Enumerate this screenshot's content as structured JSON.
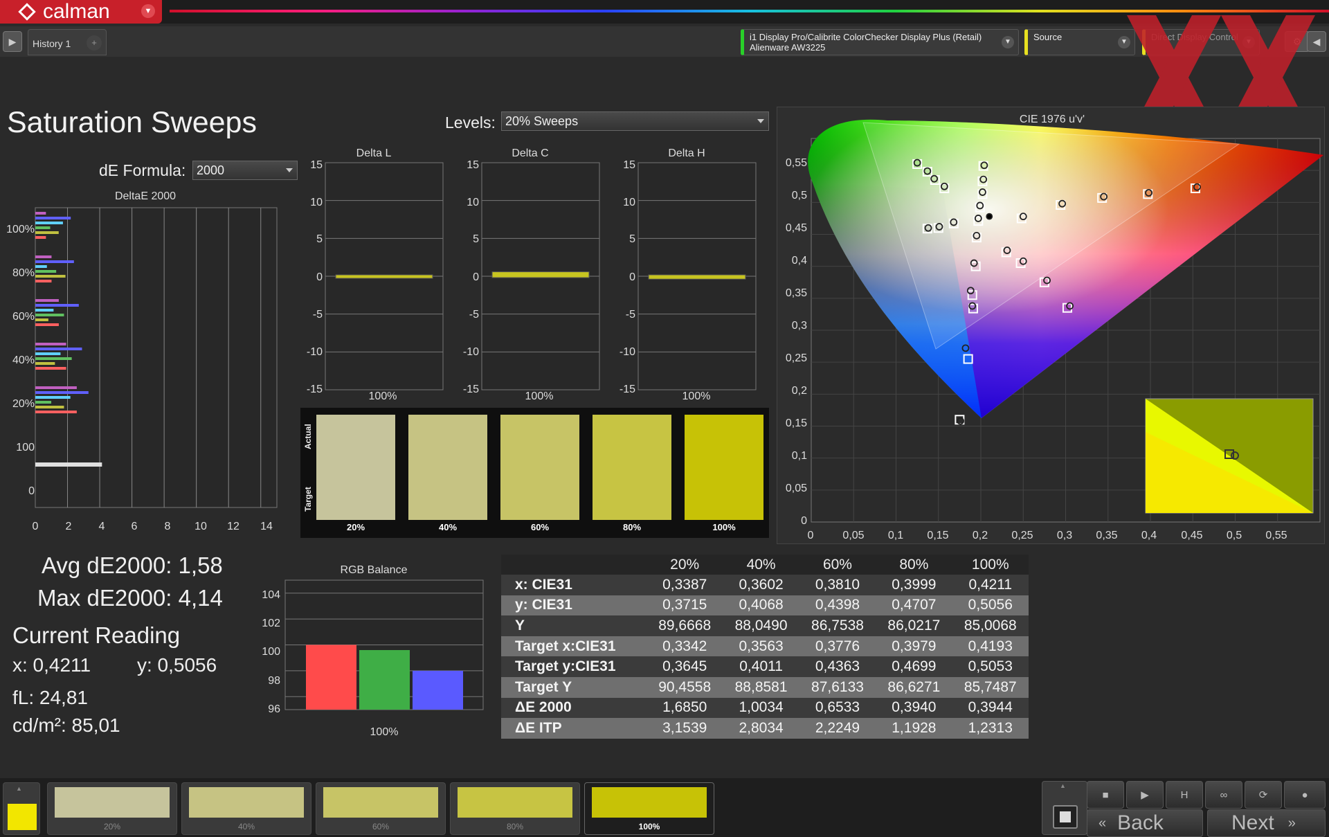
{
  "app": {
    "logo_text": "calman"
  },
  "tab": {
    "label": "History 1",
    "add": "+"
  },
  "devices": {
    "meter_line1": "i1 Display Pro/Calibrite ColorChecker Display Plus (Retail)",
    "meter_line2": "Alienware AW3225",
    "source": "Source",
    "display_control": "Direct Display Control"
  },
  "page": {
    "title": "Saturation Sweeps",
    "levels_label": "Levels:",
    "levels_value": "20% Sweeps",
    "de_label": "dE Formula:",
    "de_value": "2000"
  },
  "charts": {
    "deltae": {
      "title": "DeltaE 2000",
      "y_ticks": [
        "100%",
        "80%",
        "60%",
        "40%",
        "20%",
        "100",
        "0"
      ],
      "x_ticks": [
        "0",
        "2",
        "4",
        "6",
        "8",
        "10",
        "12",
        "14"
      ]
    },
    "delta_l": {
      "title": "Delta L",
      "y_ticks": [
        "15",
        "10",
        "5",
        "0",
        "-5",
        "-10",
        "-15"
      ],
      "x_label": "100%"
    },
    "delta_c": {
      "title": "Delta C",
      "y_ticks": [
        "15",
        "10",
        "5",
        "0",
        "-5",
        "-10",
        "-15"
      ],
      "x_label": "100%"
    },
    "delta_h": {
      "title": "Delta H",
      "y_ticks": [
        "15",
        "10",
        "5",
        "0",
        "-5",
        "-10",
        "-15"
      ],
      "x_label": "100%"
    },
    "rgb": {
      "title": "RGB Balance",
      "y_ticks": [
        "104",
        "102",
        "100",
        "98",
        "96"
      ],
      "x_label": "100%"
    },
    "cie": {
      "title": "CIE 1976 u'v'",
      "x_ticks": [
        "0",
        "0,05",
        "0,1",
        "0,15",
        "0,2",
        "0,25",
        "0,3",
        "0,35",
        "0,4",
        "0,45",
        "0,5",
        "0,55"
      ],
      "y_ticks": [
        "0,55",
        "0,5",
        "0,45",
        "0,4",
        "0,35",
        "0,3",
        "0,25",
        "0,2",
        "0,15",
        "0,1",
        "0,05",
        "0"
      ]
    }
  },
  "swatches": {
    "actual_label": "Actual",
    "target_label": "Target",
    "items": [
      {
        "label": "20%",
        "color": "#c6c49c"
      },
      {
        "label": "40%",
        "color": "#c6c383"
      },
      {
        "label": "60%",
        "color": "#c7c466"
      },
      {
        "label": "80%",
        "color": "#c7c443"
      },
      {
        "label": "100%",
        "color": "#c7c206"
      }
    ]
  },
  "stats": {
    "avg": "Avg dE2000: 1,58",
    "max": "Max dE2000: 4,14",
    "current": "Current Reading",
    "x": "x: 0,4211",
    "y": "y: 0,5056",
    "fl": "fL: 24,81",
    "cdm": "cd/m²: 85,01"
  },
  "table": {
    "headers": [
      "",
      "20%",
      "40%",
      "60%",
      "80%",
      "100%"
    ],
    "rows": [
      [
        "x: CIE31",
        "0,3387",
        "0,3602",
        "0,3810",
        "0,3999",
        "0,4211"
      ],
      [
        "y: CIE31",
        "0,3715",
        "0,4068",
        "0,4398",
        "0,4707",
        "0,5056"
      ],
      [
        "Y",
        "89,6668",
        "88,0490",
        "86,7538",
        "86,0217",
        "85,0068"
      ],
      [
        "Target x:CIE31",
        "0,3342",
        "0,3563",
        "0,3776",
        "0,3979",
        "0,4193"
      ],
      [
        "Target y:CIE31",
        "0,3645",
        "0,4011",
        "0,4363",
        "0,4699",
        "0,5053"
      ],
      [
        "Target Y",
        "90,4558",
        "88,8581",
        "87,6133",
        "86,6271",
        "85,7487"
      ],
      [
        "ΔE 2000",
        "1,6850",
        "1,0034",
        "0,6533",
        "0,3940",
        "0,3944"
      ],
      [
        "ΔE ITP",
        "3,1539",
        "2,8034",
        "2,2249",
        "1,1928",
        "1,2313"
      ]
    ]
  },
  "bottom": {
    "current_color": "#f2e600",
    "items": [
      {
        "label": "20%",
        "color": "#c6c49c"
      },
      {
        "label": "40%",
        "color": "#c6c383"
      },
      {
        "label": "60%",
        "color": "#c7c466"
      },
      {
        "label": "80%",
        "color": "#c7c443"
      },
      {
        "label": "100%",
        "color": "#c7c206"
      }
    ],
    "back": "Back",
    "next": "Next"
  },
  "chart_data": [
    {
      "type": "bar",
      "title": "DeltaE 2000",
      "orientation": "horizontal",
      "categories": [
        "100%",
        "80%",
        "60%",
        "40%",
        "20%",
        "100"
      ],
      "values": [
        2.2,
        2.4,
        2.7,
        2.9,
        3.3,
        4.14
      ],
      "xlim": [
        0,
        15
      ]
    },
    {
      "type": "bar",
      "title": "Delta L",
      "categories": [
        "100%"
      ],
      "values": [
        0
      ],
      "ylim": [
        -15,
        15
      ]
    },
    {
      "type": "bar",
      "title": "Delta C",
      "categories": [
        "100%"
      ],
      "values": [
        0.4
      ],
      "ylim": [
        -15,
        15
      ]
    },
    {
      "type": "bar",
      "title": "Delta H",
      "categories": [
        "100%"
      ],
      "values": [
        -0.2
      ],
      "ylim": [
        -15,
        15
      ]
    },
    {
      "type": "bar",
      "title": "RGB Balance",
      "categories": [
        "100%"
      ],
      "series": [
        {
          "color": "#ff4b4b",
          "values": [
            100
          ]
        },
        {
          "color": "#3fae46",
          "values": [
            99.6
          ]
        },
        {
          "color": "#5a5aff",
          "values": [
            98
          ]
        }
      ],
      "ylim": [
        95,
        105
      ]
    },
    {
      "type": "scatter",
      "title": "CIE 1976 u'v'",
      "xlim": [
        0,
        0.6
      ],
      "ylim": [
        0,
        0.6
      ],
      "series": [
        {
          "name": "target",
          "values": [
            [
              0.125,
              0.56
            ],
            [
              0.137,
              0.548
            ],
            [
              0.146,
              0.535
            ],
            [
              0.157,
              0.522
            ],
            [
              0.203,
              0.557
            ],
            [
              0.202,
              0.533
            ],
            [
              0.202,
              0.513
            ],
            [
              0.199,
              0.492
            ],
            [
              0.197,
              0.471
            ],
            [
              0.137,
              0.459
            ],
            [
              0.15,
              0.46
            ],
            [
              0.168,
              0.467
            ],
            [
              0.195,
              0.445
            ],
            [
              0.23,
              0.422
            ],
            [
              0.247,
              0.405
            ],
            [
              0.275,
              0.375
            ],
            [
              0.302,
              0.335
            ],
            [
              0.191,
              0.334
            ],
            [
              0.194,
              0.4
            ],
            [
              0.19,
              0.355
            ],
            [
              0.185,
              0.255
            ],
            [
              0.175,
              0.16
            ],
            [
              0.248,
              0.475
            ],
            [
              0.294,
              0.496
            ],
            [
              0.343,
              0.507
            ],
            [
              0.397,
              0.513
            ],
            [
              0.453,
              0.522
            ]
          ]
        },
        {
          "name": "measured",
          "values": [
            [
              0.125,
              0.562
            ],
            [
              0.137,
              0.549
            ],
            [
              0.145,
              0.537
            ],
            [
              0.157,
              0.525
            ],
            [
              0.204,
              0.558
            ],
            [
              0.203,
              0.536
            ],
            [
              0.202,
              0.516
            ],
            [
              0.199,
              0.495
            ],
            [
              0.197,
              0.475
            ],
            [
              0.138,
              0.46
            ],
            [
              0.151,
              0.462
            ],
            [
              0.168,
              0.469
            ],
            [
              0.195,
              0.448
            ],
            [
              0.231,
              0.425
            ],
            [
              0.25,
              0.408
            ],
            [
              0.278,
              0.378
            ],
            [
              0.305,
              0.338
            ],
            [
              0.19,
              0.338
            ],
            [
              0.192,
              0.405
            ],
            [
              0.188,
              0.362
            ],
            [
              0.182,
              0.272
            ],
            [
              0.176,
              0.158
            ],
            [
              0.25,
              0.478
            ],
            [
              0.296,
              0.498
            ],
            [
              0.345,
              0.509
            ],
            [
              0.398,
              0.515
            ],
            [
              0.455,
              0.524
            ],
            [
              0.21,
              0.478
            ]
          ]
        }
      ]
    }
  ]
}
